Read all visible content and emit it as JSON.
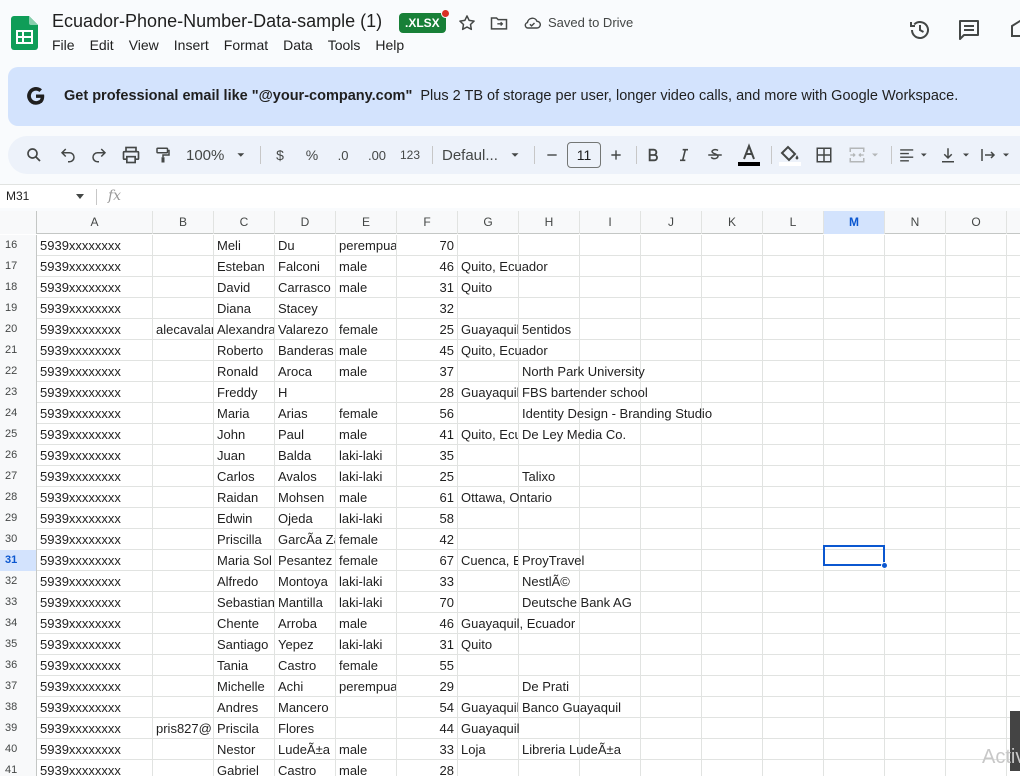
{
  "title_bar": {
    "document_title": "Ecuador-Phone-Number-Data-sample (1)",
    "format_badge": ".XLSX",
    "save_status": "Saved to Drive"
  },
  "menu": [
    "File",
    "Edit",
    "View",
    "Insert",
    "Format",
    "Data",
    "Tools",
    "Help"
  ],
  "banner": {
    "bold_text": "Get professional email like \"@your-company.com\"",
    "rest_text": "Plus 2 TB of storage per user, longer video calls, and more with Google Workspace."
  },
  "toolbar": {
    "zoom": "100%",
    "currency": "$",
    "percent": "%",
    "decrease_decimal": ".0",
    "increase_decimal": ".00",
    "number_format": "123",
    "font": "Defaul...",
    "font_size": "11"
  },
  "formula_bar": {
    "name_box": "M31",
    "fx_label": "fx"
  },
  "columns": [
    "A",
    "B",
    "C",
    "D",
    "E",
    "F",
    "G",
    "H",
    "I",
    "J",
    "K",
    "L",
    "M",
    "N",
    "O"
  ],
  "selected_column": "M",
  "selected_row": "31",
  "rows": [
    {
      "n": "16",
      "a": "5939xxxxxxxx",
      "b": "",
      "c": "Meli",
      "d": "Du",
      "e": "perempuan",
      "f": "70",
      "g": "",
      "h": ""
    },
    {
      "n": "17",
      "a": "5939xxxxxxxx",
      "b": "",
      "c": "Esteban",
      "d": "Falconi",
      "e": "male",
      "f": "46",
      "g": "Quito, Ecuador",
      "h": ""
    },
    {
      "n": "18",
      "a": "5939xxxxxxxx",
      "b": "",
      "c": "David",
      "d": "Carrasco",
      "e": "male",
      "f": "31",
      "g": "Quito",
      "h": ""
    },
    {
      "n": "19",
      "a": "5939xxxxxxxx",
      "b": "",
      "c": "Diana",
      "d": "Stacey",
      "e": "",
      "f": "32",
      "g": "",
      "h": ""
    },
    {
      "n": "20",
      "a": "5939xxxxxxxx",
      "b": "alecavalaro",
      "c": "Alexandra",
      "d": "Valarezo",
      "e": "female",
      "f": "25",
      "g": "Guayaquil",
      "h": "5entidos"
    },
    {
      "n": "21",
      "a": "5939xxxxxxxx",
      "b": "",
      "c": "Roberto",
      "d": "Banderas",
      "e": "male",
      "f": "45",
      "g": "Quito, Ecuador",
      "h": ""
    },
    {
      "n": "22",
      "a": "5939xxxxxxxx",
      "b": "",
      "c": "Ronald",
      "d": "Aroca",
      "e": "male",
      "f": "37",
      "g": "",
      "h": "North Park University"
    },
    {
      "n": "23",
      "a": "5939xxxxxxxx",
      "b": "",
      "c": "Freddy",
      "d": "H",
      "e": "",
      "f": "28",
      "g": "Guayaquil",
      "h": "FBS bartender school"
    },
    {
      "n": "24",
      "a": "5939xxxxxxxx",
      "b": "",
      "c": "Maria",
      "d": "Arias",
      "e": "female",
      "f": "56",
      "g": "",
      "h": "Identity Design - Branding Studio"
    },
    {
      "n": "25",
      "a": "5939xxxxxxxx",
      "b": "",
      "c": "John",
      "d": "Paul",
      "e": "male",
      "f": "41",
      "g": "Quito, Ecuador",
      "h": "De Ley Media Co."
    },
    {
      "n": "26",
      "a": "5939xxxxxxxx",
      "b": "",
      "c": "Juan",
      "d": "Balda",
      "e": "laki-laki",
      "f": "35",
      "g": "",
      "h": ""
    },
    {
      "n": "27",
      "a": "5939xxxxxxxx",
      "b": "",
      "c": "Carlos",
      "d": "Avalos",
      "e": "laki-laki",
      "f": "25",
      "g": "",
      "h": "Talixo"
    },
    {
      "n": "28",
      "a": "5939xxxxxxxx",
      "b": "",
      "c": "Raidan",
      "d": "Mohsen",
      "e": "male",
      "f": "61",
      "g": "Ottawa, Ontario",
      "h": ""
    },
    {
      "n": "29",
      "a": "5939xxxxxxxx",
      "b": "",
      "c": "Edwin",
      "d": "Ojeda",
      "e": "laki-laki",
      "f": "58",
      "g": "",
      "h": ""
    },
    {
      "n": "30",
      "a": "5939xxxxxxxx",
      "b": "",
      "c": "Priscilla",
      "d": "GarcÃ­a Zambrano",
      "e": "female",
      "f": "42",
      "g": "",
      "h": ""
    },
    {
      "n": "31",
      "a": "5939xxxxxxxx",
      "b": "",
      "c": "Maria Sol",
      "d": "Pesantez",
      "e": "female",
      "f": "67",
      "g": "Cuenca, Ecuador",
      "h": "ProyTravel"
    },
    {
      "n": "32",
      "a": "5939xxxxxxxx",
      "b": "",
      "c": "Alfredo",
      "d": "Montoya",
      "e": "laki-laki",
      "f": "33",
      "g": "",
      "h": "NestlÃ©"
    },
    {
      "n": "33",
      "a": "5939xxxxxxxx",
      "b": "",
      "c": "Sebastian",
      "d": "Mantilla",
      "e": "laki-laki",
      "f": "70",
      "g": "",
      "h": "Deutsche Bank AG"
    },
    {
      "n": "34",
      "a": "5939xxxxxxxx",
      "b": "",
      "c": "Chente",
      "d": "Arroba",
      "e": "male",
      "f": "46",
      "g": "Guayaquil, Ecuador",
      "h": ""
    },
    {
      "n": "35",
      "a": "5939xxxxxxxx",
      "b": "",
      "c": "Santiago",
      "d": "Yepez",
      "e": "laki-laki",
      "f": "31",
      "g": "Quito",
      "h": ""
    },
    {
      "n": "36",
      "a": "5939xxxxxxxx",
      "b": "",
      "c": "Tania",
      "d": "Castro",
      "e": "female",
      "f": "55",
      "g": "",
      "h": ""
    },
    {
      "n": "37",
      "a": "5939xxxxxxxx",
      "b": "",
      "c": "Michelle",
      "d": "Achi",
      "e": "perempuan",
      "f": "29",
      "g": "",
      "h": "De Prati"
    },
    {
      "n": "38",
      "a": "5939xxxxxxxx",
      "b": "",
      "c": "Andres",
      "d": "Mancero",
      "e": "",
      "f": "54",
      "g": "Guayaquil",
      "h": "Banco Guayaquil"
    },
    {
      "n": "39",
      "a": "5939xxxxxxxx",
      "b": "pris827@",
      "c": "Priscila",
      "d": "Flores",
      "e": "",
      "f": "44",
      "g": "Guayaquil",
      "h": ""
    },
    {
      "n": "40",
      "a": "5939xxxxxxxx",
      "b": "",
      "c": "Nestor",
      "d": "LudeÃ±a",
      "e": "male",
      "f": "33",
      "g": "Loja",
      "h": "Libreria LudeÃ±a"
    },
    {
      "n": "41",
      "a": "5939xxxxxxxx",
      "b": "",
      "c": "Gabriel",
      "d": "Castro",
      "e": "male",
      "f": "28",
      "g": "",
      "h": ""
    }
  ],
  "watermark": "Activ"
}
